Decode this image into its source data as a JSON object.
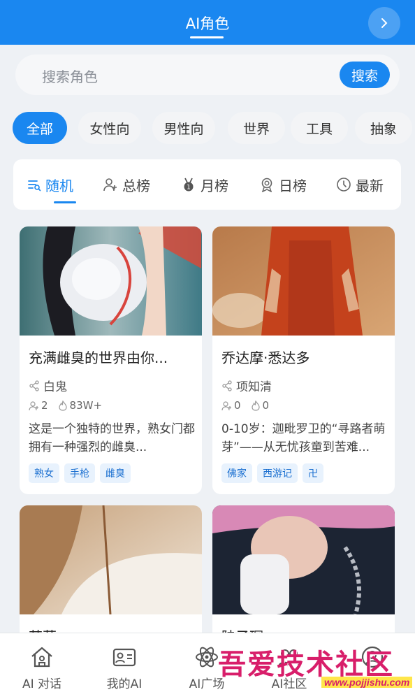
{
  "header": {
    "title": "AI角色"
  },
  "search": {
    "placeholder": "搜索角色",
    "button": "搜索"
  },
  "categories": [
    "全部",
    "女性向",
    "男性向",
    "世界",
    "工具",
    "抽象"
  ],
  "sort_tabs": [
    "随机",
    "总榜",
    "月榜",
    "日榜",
    "最新"
  ],
  "cards": [
    {
      "name": "充满雌臭的世界由你...",
      "author": "白鬼",
      "users": "2",
      "heat": "83W+",
      "description": "这是一个独特的世界，熟女门都拥有一种强烈的雌臭...",
      "tags": [
        "熟女",
        "手枪",
        "雌臭"
      ]
    },
    {
      "name": "乔达摩·悉达多",
      "author": "项知清",
      "users": "0",
      "heat": "0",
      "description": "0-10岁：迦毗罗卫的“寻路者萌芽”——从无忧孩童到苦难...",
      "tags": [
        "佛家",
        "西游记",
        "卍"
      ]
    },
    {
      "name": "茉莉"
    },
    {
      "name": "陆子琛"
    }
  ],
  "bottom_nav": [
    "AI 对话",
    "我的AI",
    "AI广场",
    "AI社区"
  ],
  "watermark": {
    "text": "吾爱技术社区",
    "url": "www.pojjishu.com"
  }
}
